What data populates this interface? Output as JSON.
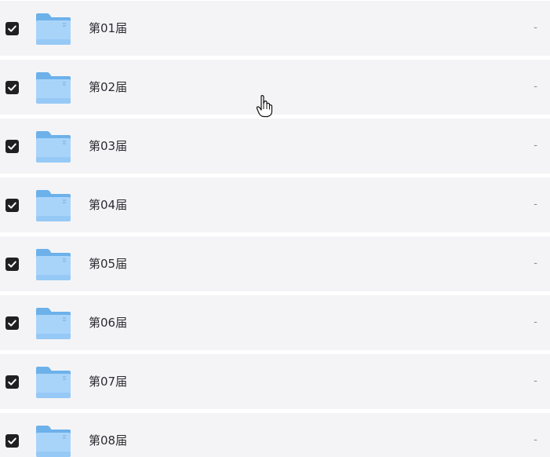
{
  "rows": [
    {
      "name": "第01届",
      "size": "-",
      "checked": true,
      "icon": "folder-icon"
    },
    {
      "name": "第02届",
      "size": "-",
      "checked": true,
      "icon": "folder-icon"
    },
    {
      "name": "第03届",
      "size": "-",
      "checked": true,
      "icon": "folder-icon"
    },
    {
      "name": "第04届",
      "size": "-",
      "checked": true,
      "icon": "folder-icon"
    },
    {
      "name": "第05届",
      "size": "-",
      "checked": true,
      "icon": "folder-icon"
    },
    {
      "name": "第06届",
      "size": "-",
      "checked": true,
      "icon": "folder-icon"
    },
    {
      "name": "第07届",
      "size": "-",
      "checked": true,
      "icon": "folder-icon"
    },
    {
      "name": "第08届",
      "size": "-",
      "checked": true,
      "icon": "folder-icon"
    }
  ],
  "colors": {
    "row_background": "#f4f4f6",
    "checkbox": "#1f1f24",
    "folder": "#8fc6f4"
  },
  "cursor": "hand-pointer-icon"
}
